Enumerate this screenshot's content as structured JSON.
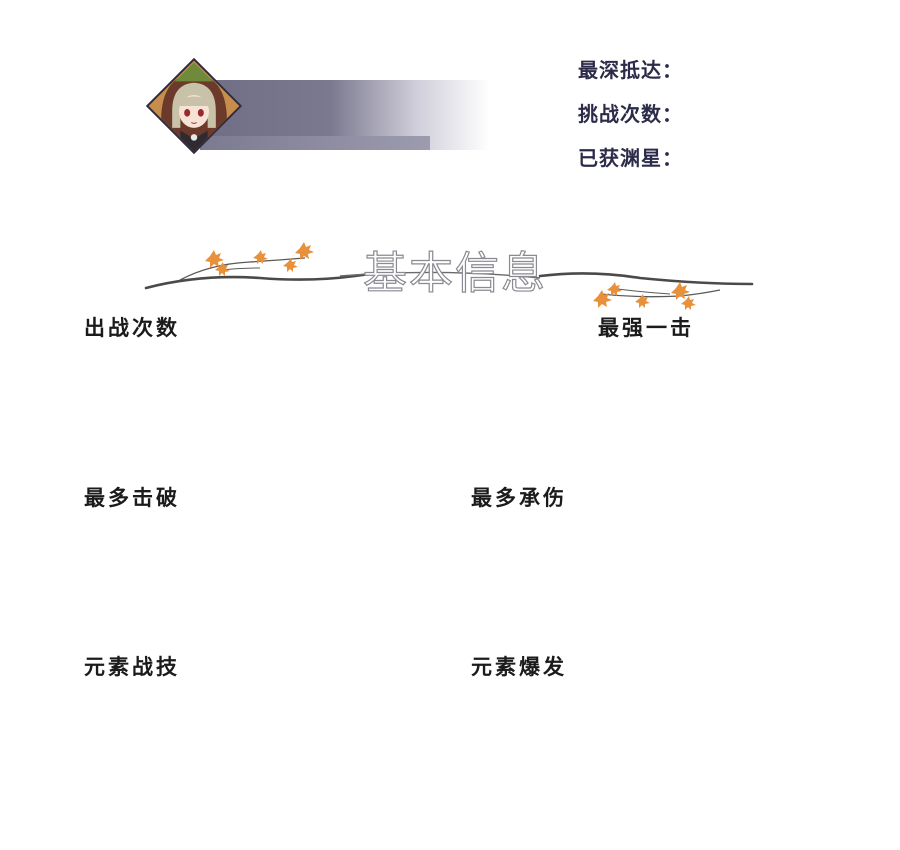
{
  "header": {
    "stats": [
      {
        "label": "最深抵达："
      },
      {
        "label": "挑战次数："
      },
      {
        "label": "已获渊星："
      }
    ]
  },
  "section": {
    "title": "基本信息"
  },
  "records": {
    "battle_count": "出战次数",
    "strongest_hit": "最强一击",
    "most_defeats": "最多击破",
    "most_damage_taken": "最多承伤",
    "elemental_skill": "元素战技",
    "elemental_burst": "元素爆发"
  },
  "colors": {
    "banner": "#6f6e85",
    "stat_text": "#2c2c4a",
    "label_text": "#1b1b1b",
    "leaf": "#e8913a",
    "branch": "#4a4a4a"
  },
  "icons": {
    "avatar": "character-portrait",
    "leaf": "maple-leaf-icon"
  }
}
